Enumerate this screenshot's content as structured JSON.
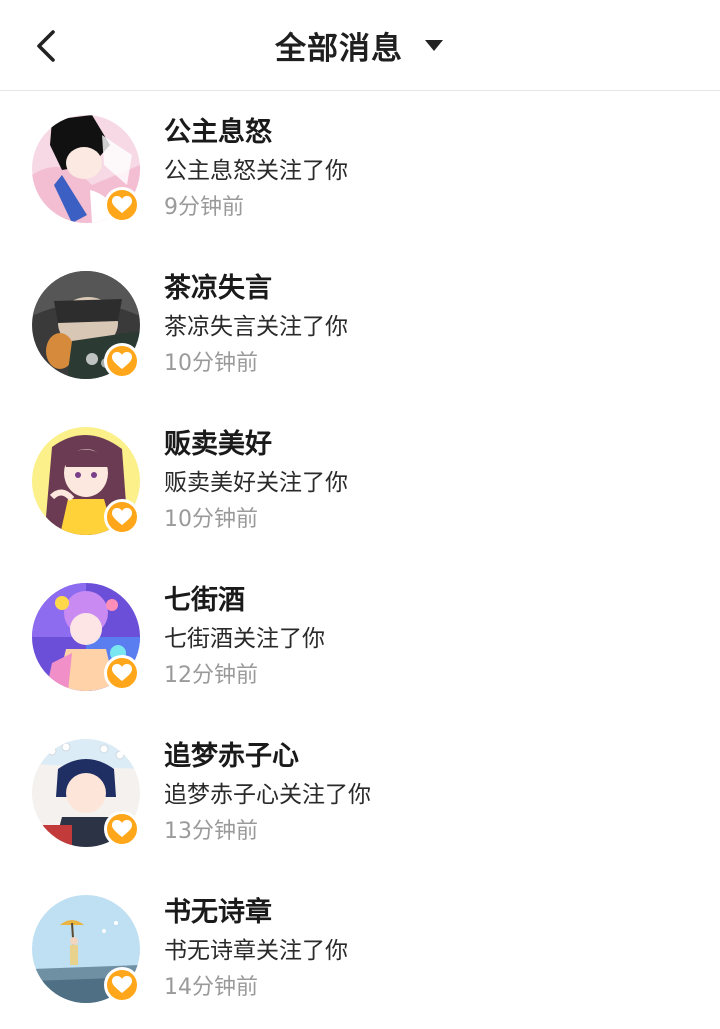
{
  "header": {
    "title": "全部消息",
    "back_icon": "chevron-left-icon",
    "dropdown_icon": "caret-down-icon"
  },
  "colors": {
    "badge": "#ffa61a",
    "time_text": "#9a9a9a",
    "divider": "#e6e6e6"
  },
  "messages": [
    {
      "name": "公主息怒",
      "text": "公主息怒关注了你",
      "time": "9分钟前"
    },
    {
      "name": "茶凉失言",
      "text": "茶凉失言关注了你",
      "time": "10分钟前"
    },
    {
      "name": "贩卖美好",
      "text": "贩卖美好关注了你",
      "time": "10分钟前"
    },
    {
      "name": "七街酒",
      "text": "七街酒关注了你",
      "time": "12分钟前"
    },
    {
      "name": "追梦赤子心",
      "text": "追梦赤子心关注了你",
      "time": "13分钟前"
    },
    {
      "name": "书无诗章",
      "text": "书无诗章关注了你",
      "time": "14分钟前"
    }
  ]
}
